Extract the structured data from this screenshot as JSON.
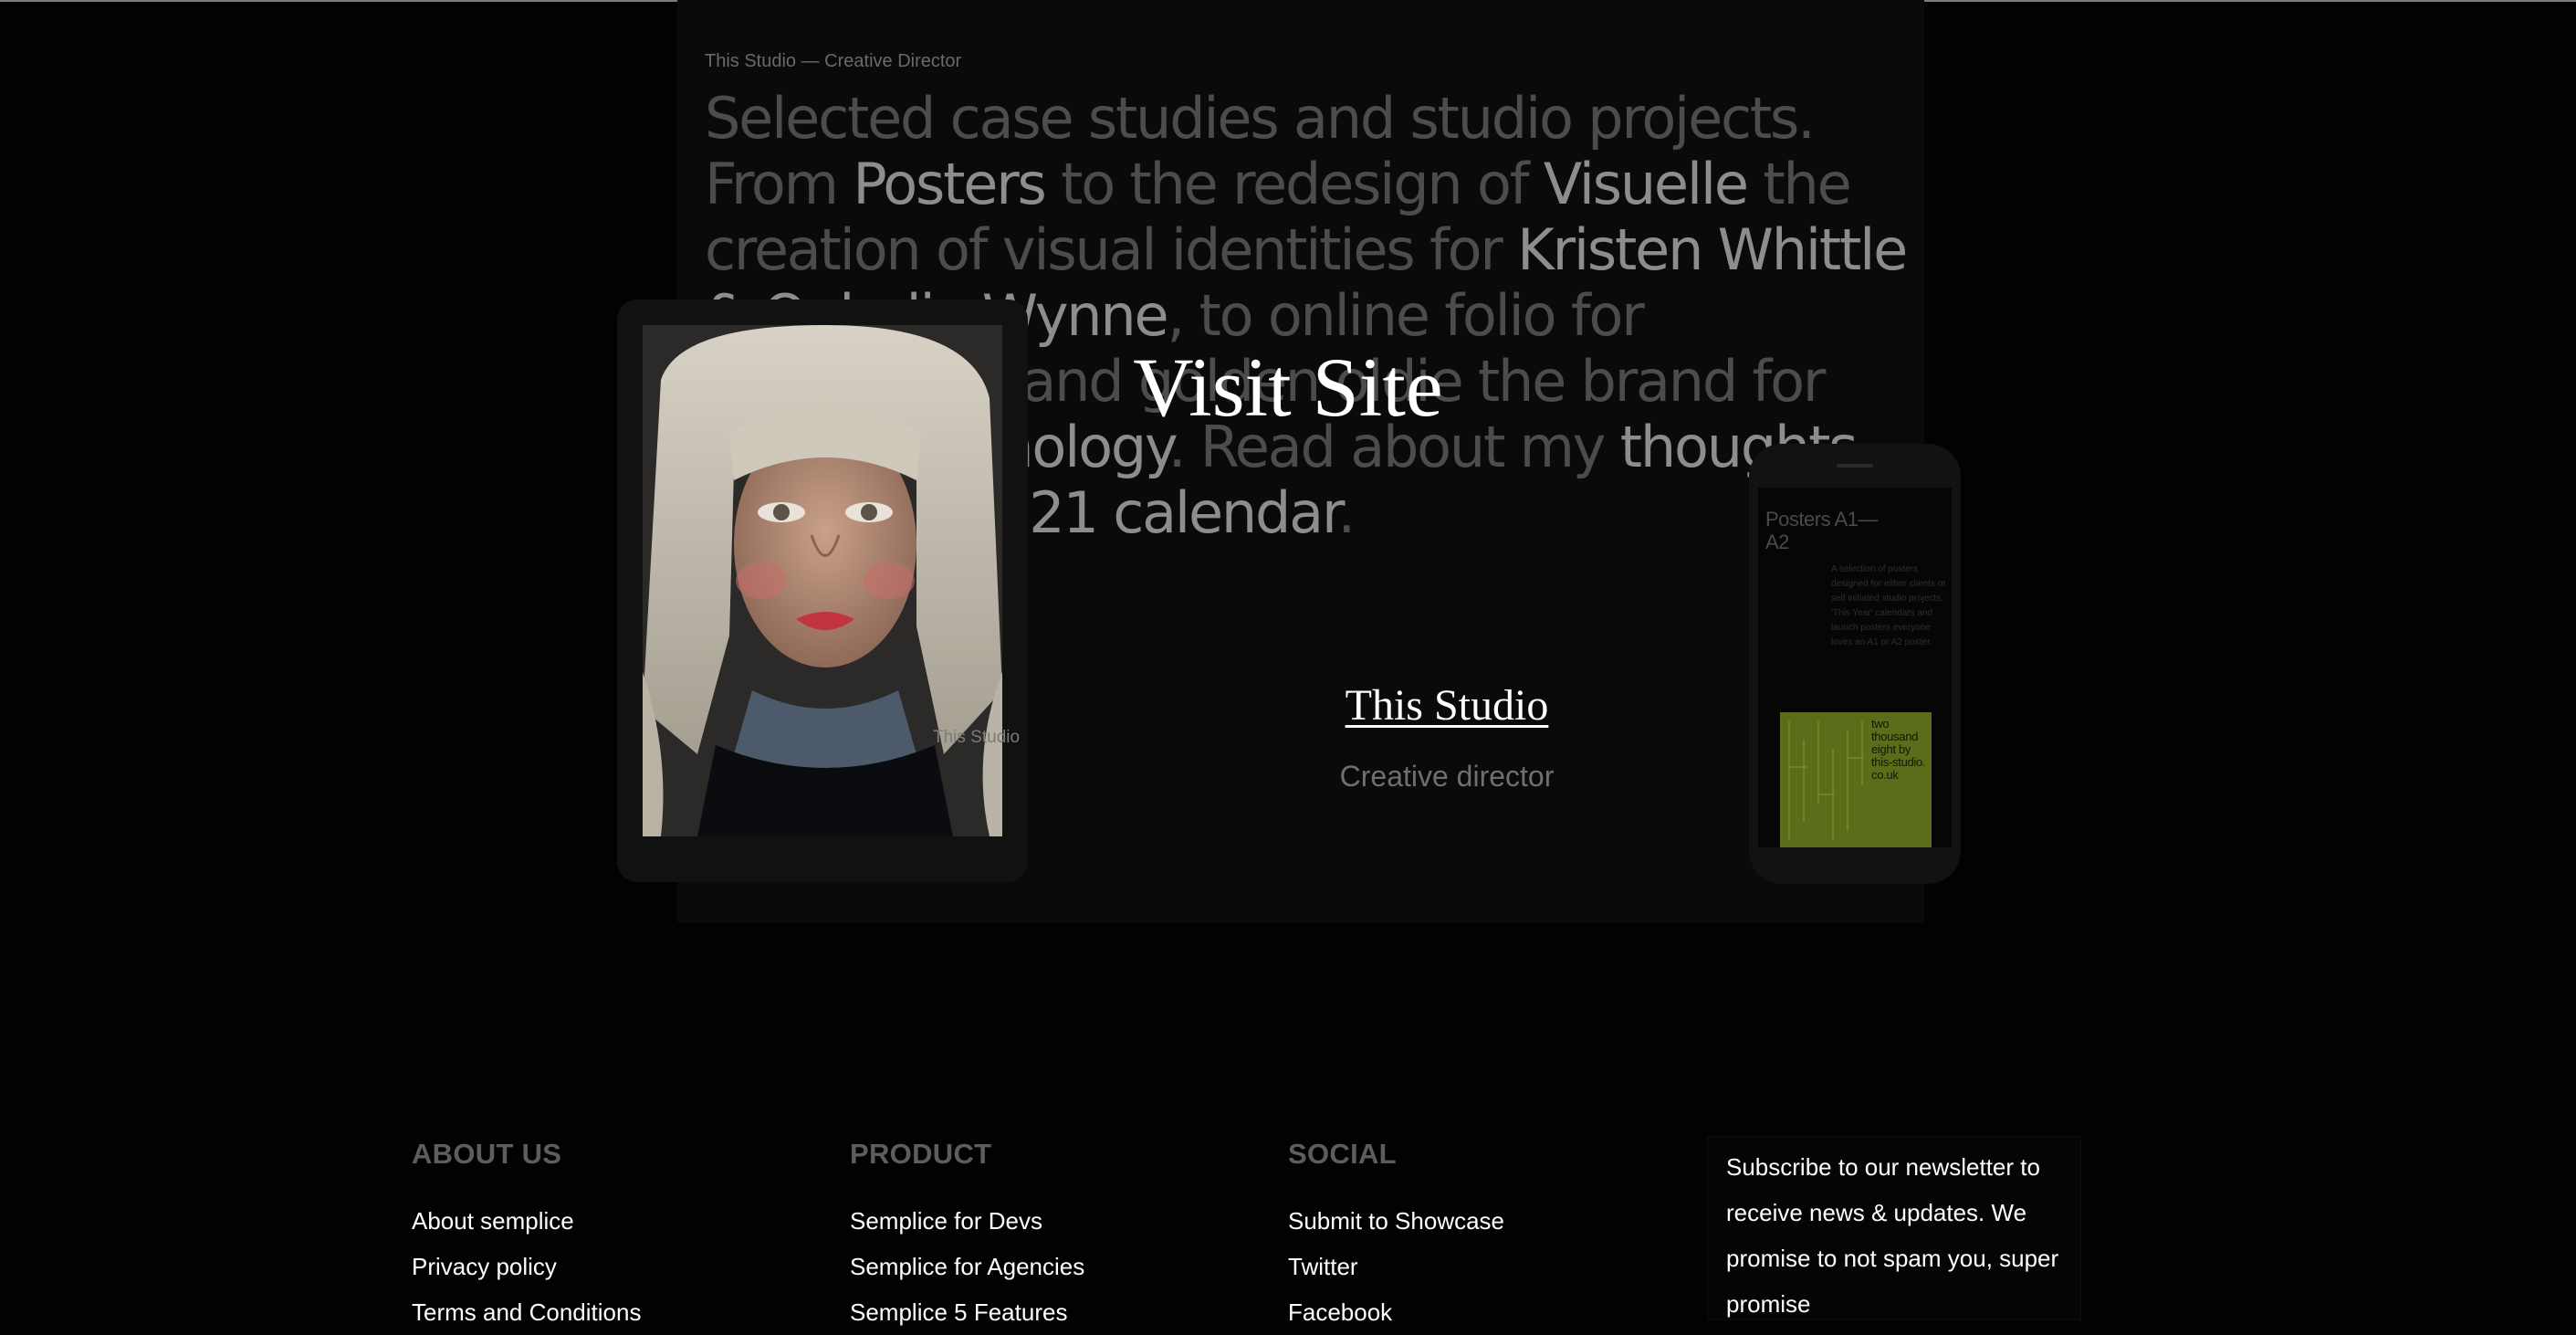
{
  "hero": {
    "eyebrow": "This Studio — Creative Director",
    "lede": [
      {
        "t": "Selected case studies and studio projects. From ",
        "b": false
      },
      {
        "t": "Posters",
        "b": true
      },
      {
        "t": " to the redesign of ",
        "b": false
      },
      {
        "t": "Visuelle",
        "b": true
      },
      {
        "t": " the creation of visual identities for ",
        "b": false
      },
      {
        "t": "Kristen Whittle & Ophelia Wynne",
        "b": true
      },
      {
        "t": ", to online folio for community and golden oldie the brand for Parish ",
        "b": false
      },
      {
        "t": "Technology",
        "b": true
      },
      {
        "t": ". Read about my ",
        "b": false
      },
      {
        "t": "thoughts",
        "b": true
      },
      {
        "t": " or grab a ",
        "b": false
      },
      {
        "t": "2021 calendar",
        "b": true
      },
      {
        "t": ".",
        "b": false
      }
    ]
  },
  "tablet": {
    "caption": "This Studio"
  },
  "phone": {
    "title": "Posters A1—A2",
    "description": "A selection of posters designed for either clients or self initiated studio projects. 'This Year' calendars and launch posters everyone loves an A1 or A2 poster.",
    "poster_text": "two thousand eight by this-studio. co.uk",
    "poster_color": "#5a6e1a"
  },
  "overlay": {
    "visit_site": "Visit Site",
    "studio_name": "This Studio",
    "studio_role": "Creative director"
  },
  "footer": {
    "about": {
      "heading": "ABOUT US",
      "links": [
        "About semplice",
        "Privacy policy",
        "Terms and Conditions"
      ]
    },
    "product": {
      "heading": "PRODUCT",
      "links": [
        "Semplice for Devs",
        "Semplice for Agencies",
        "Semplice 5 Features"
      ]
    },
    "social": {
      "heading": "SOCIAL",
      "links": [
        "Submit to Showcase",
        "Twitter",
        "Facebook"
      ]
    },
    "newsletter": "Subscribe to our newsletter to receive news & updates. We promise to not spam you, super promise"
  }
}
